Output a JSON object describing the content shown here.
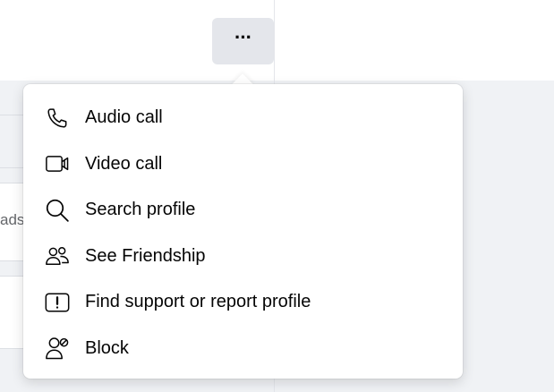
{
  "header": {
    "more_button_label": "···"
  },
  "background": {
    "fragment_text": "ads"
  },
  "menu": {
    "items": [
      {
        "label": "Audio call",
        "icon": "phone-icon"
      },
      {
        "label": "Video call",
        "icon": "video-camera-icon"
      },
      {
        "label": "Search profile",
        "icon": "search-icon"
      },
      {
        "label": "See Friendship",
        "icon": "friends-icon"
      },
      {
        "label": "Find support or report profile",
        "icon": "report-icon"
      },
      {
        "label": "Block",
        "icon": "block-user-icon"
      }
    ]
  }
}
